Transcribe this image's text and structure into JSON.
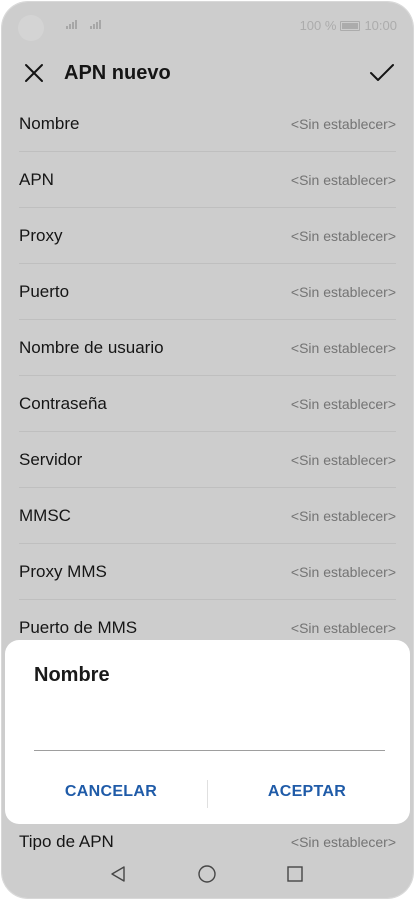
{
  "status_bar": {
    "battery": "100 %",
    "time": "10:00"
  },
  "header": {
    "title": "APN nuevo",
    "close_icon": "close-icon",
    "confirm_icon": "check-icon"
  },
  "rows": [
    {
      "label": "Nombre",
      "value": "<Sin establecer>"
    },
    {
      "label": "APN",
      "value": "<Sin establecer>"
    },
    {
      "label": "Proxy",
      "value": "<Sin establecer>"
    },
    {
      "label": "Puerto",
      "value": "<Sin establecer>"
    },
    {
      "label": "Nombre de usuario",
      "value": "<Sin establecer>"
    },
    {
      "label": "Contraseña",
      "value": "<Sin establecer>"
    },
    {
      "label": "Servidor",
      "value": "<Sin establecer>"
    },
    {
      "label": "MMSC",
      "value": "<Sin establecer>"
    },
    {
      "label": "Proxy MMS",
      "value": "<Sin establecer>"
    },
    {
      "label": "Puerto de MMS",
      "value": "<Sin establecer>"
    },
    {
      "label": "Tipo de APN",
      "value": "<Sin establecer>"
    }
  ],
  "dialog": {
    "title": "Nombre",
    "input_value": "",
    "cancel_label": "CANCELAR",
    "accept_label": "ACEPTAR"
  },
  "colors": {
    "accent": "#1f5ba8",
    "scrim": "#000000"
  },
  "nav_bar": {
    "back_icon": "back-triangle-icon",
    "home_icon": "home-circle-icon",
    "recents_icon": "recents-square-icon"
  }
}
